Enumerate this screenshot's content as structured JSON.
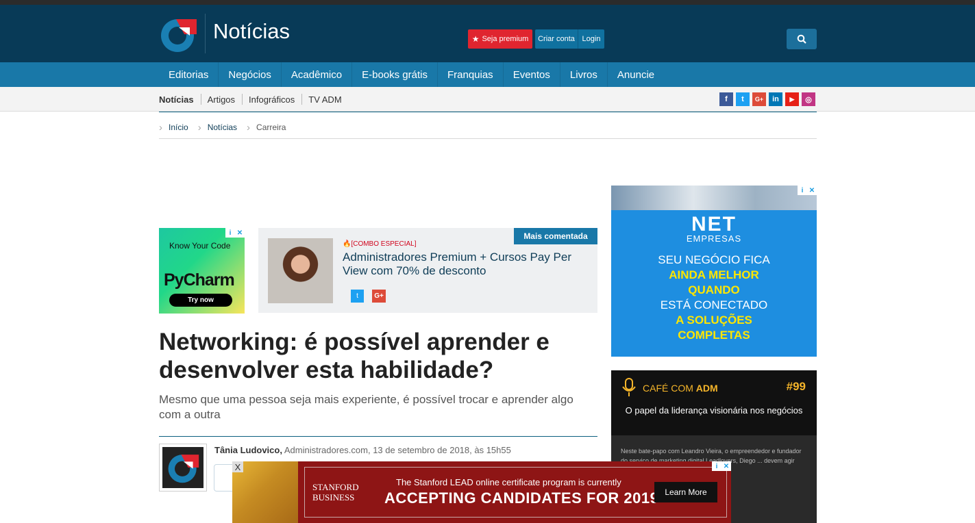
{
  "header": {
    "site_title": "Notícias",
    "premium_label": "Seja premium",
    "criar_label": "Criar conta",
    "login_label": "Login"
  },
  "mainnav": [
    "Editorias",
    "Negócios",
    "Acadêmico",
    "E-books grátis",
    "Franquias",
    "Eventos",
    "Livros",
    "Anuncie"
  ],
  "subnav": [
    "Notícias",
    "Artigos",
    "Infográficos",
    "TV ADM"
  ],
  "social": [
    "f",
    "t",
    "G+",
    "in",
    "▶",
    "◎"
  ],
  "breadcrumb": [
    "Início",
    "Notícias",
    "Carreira"
  ],
  "ad_pycharm": {
    "line1": "Know Your Code",
    "line2": "PyCharm",
    "cta": "Try now"
  },
  "promo": {
    "tag": "Mais comentada",
    "kicker": "[COMBO ESPECIAL]",
    "title": "Administradores Premium + Cursos Pay Per View com 70% de desconto"
  },
  "article": {
    "headline": "Networking: é possível aprender e desenvolver esta habilidade?",
    "subheadline": "Mesmo que uma pessoa seja mais experiente, é possível trocar e aprender algo com a outra",
    "author": "Tânia Ludovico,",
    "source_date": "Administradores.com, 13 de setembro de 2018, às 15h55"
  },
  "ad_net": {
    "brand": "NET",
    "sub": "EMPRESAS",
    "lines": [
      "SEU NEGÓCIO FICA",
      "AINDA MELHOR",
      "QUANDO",
      "ESTÁ CONECTADO",
      "A SOLUÇÕES",
      "COMPLETAS"
    ]
  },
  "cafe": {
    "brand_prefix": "CAFÉ COM ",
    "brand_bold": "ADM",
    "number": "#99",
    "episode": "O papel da liderança visionária nos negócios",
    "description": "Neste bate-papo com Leandro Vieira, o empreendedor e fundador do serviço de marketing digital Leadlovers, Diego ... devem agir para ter ... necessário que tenham"
  },
  "bottom_ad": {
    "logo_line1": "STANFORD",
    "logo_line2": "BUSINESS",
    "line1": "The Stanford LEAD online certificate program is currently",
    "line2": "ACCEPTING CANDIDATES FOR 2019",
    "cta": "Learn More",
    "close": "X"
  },
  "colors": {
    "header_bg": "#083a57",
    "nav_bg": "#1978a8",
    "premium_red": "#e0252f",
    "link_dark": "#0f3d57"
  }
}
